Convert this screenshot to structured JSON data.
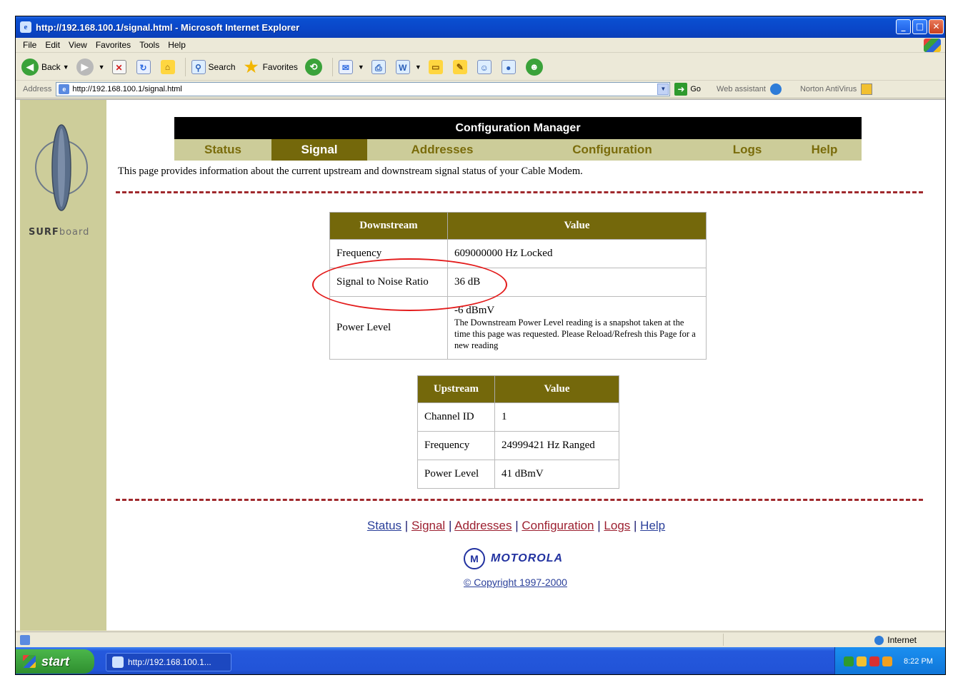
{
  "window": {
    "title": "http://192.168.100.1/signal.html - Microsoft Internet Explorer"
  },
  "menu": [
    "File",
    "Edit",
    "View",
    "Favorites",
    "Tools",
    "Help"
  ],
  "toolbar": {
    "back_label": "Back",
    "search_label": "Search",
    "favorites_label": "Favorites"
  },
  "addressbar": {
    "label": "Address",
    "url": "http://192.168.100.1/signal.html",
    "go_label": "Go",
    "web_assistant": "Web assistant",
    "norton": "Norton AntiVirus"
  },
  "page": {
    "brand_prefix": "SURF",
    "brand_suffix": "board",
    "header_title": "Configuration Manager",
    "nav": [
      {
        "label": "Status",
        "active": false
      },
      {
        "label": "Signal",
        "active": true
      },
      {
        "label": "Addresses",
        "active": false
      },
      {
        "label": "Configuration",
        "active": false
      },
      {
        "label": "Logs",
        "active": false
      },
      {
        "label": "Help",
        "active": false
      }
    ],
    "intro": "This page provides information about the current upstream and downstream signal status of your Cable Modem.",
    "downstream": {
      "header_name": "Downstream",
      "header_value": "Value",
      "rows": [
        {
          "name": "Frequency",
          "value": "609000000 Hz Locked"
        },
        {
          "name": "Signal to Noise Ratio",
          "value": "36 dB"
        },
        {
          "name": "Power Level",
          "value": "-6 dBmV",
          "note": "The Downstream Power Level reading is a snapshot taken at the time this page was requested. Please Reload/Refresh this Page for a new reading"
        }
      ]
    },
    "upstream": {
      "header_name": "Upstream",
      "header_value": "Value",
      "rows": [
        {
          "name": "Channel ID",
          "value": "1"
        },
        {
          "name": "Frequency",
          "value": "24999421 Hz Ranged"
        },
        {
          "name": "Power Level",
          "value": "41 dBmV"
        }
      ]
    },
    "footer_links": [
      "Status",
      "Signal",
      "Addresses",
      "Configuration",
      "Logs",
      "Help"
    ],
    "footer_separator": "|",
    "motorola": "MOTOROLA",
    "copyright": "© Copyright 1997-2000"
  },
  "statusbar": {
    "zone": "Internet"
  },
  "taskbar": {
    "start_label": "start",
    "task_label": "http://192.168.100.1...",
    "clock": "8:22 PM"
  },
  "colors": {
    "olive": "#74680b",
    "sidebar": "#cdcd9a",
    "nav_bg": "#cccc99",
    "highlight_ellipse": "#e31b1b"
  }
}
